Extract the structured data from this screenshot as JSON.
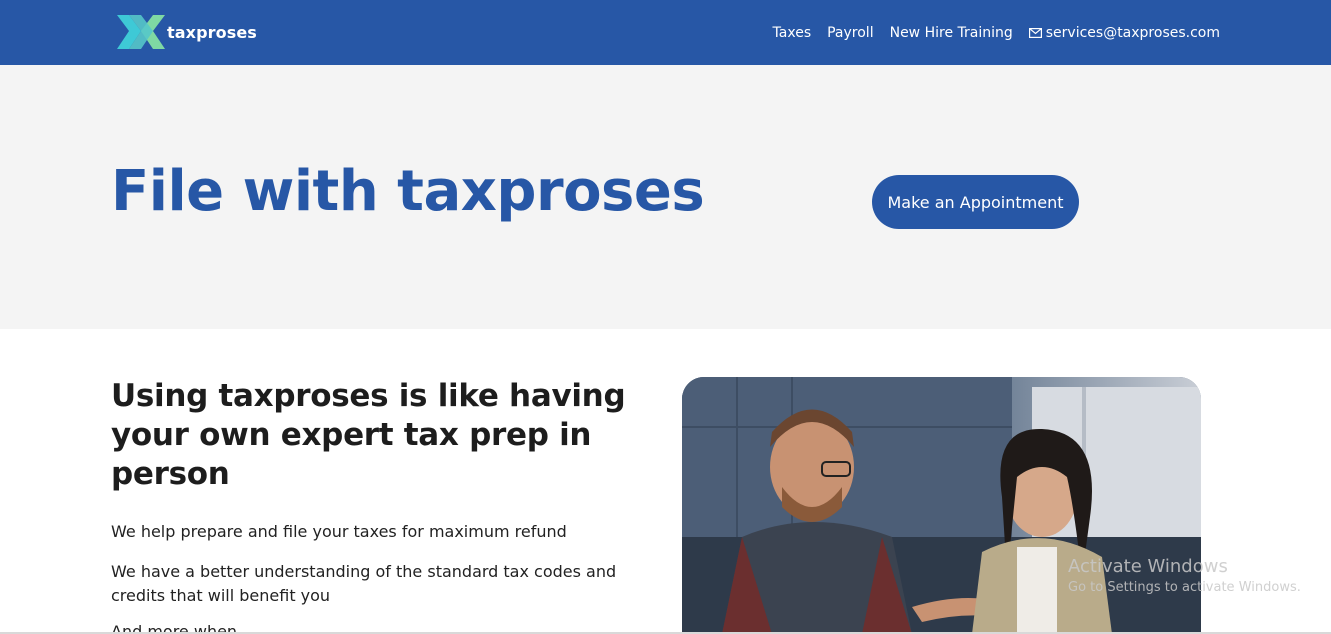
{
  "header": {
    "brand": "taxproses",
    "nav": [
      "Taxes",
      "Payroll",
      "New Hire Training"
    ],
    "email": "services@taxproses.com"
  },
  "hero": {
    "title": "File with taxproses",
    "cta_label": "Make an Appointment"
  },
  "content": {
    "heading": "Using taxproses is like having your own expert tax prep in person",
    "paragraphs": [
      "We help prepare and file your taxes for maximum refund",
      "We have a better understanding of the standard tax codes and credits that will benefit you",
      "And more when..."
    ]
  },
  "watermark": {
    "line1": "Activate Windows",
    "line2": "Go to Settings to activate Windows."
  },
  "colors": {
    "brand_blue": "#2757a6",
    "hero_bg": "#f4f4f4",
    "logo_cyan": "#3ec9d6",
    "logo_green": "#7fd9a3"
  }
}
